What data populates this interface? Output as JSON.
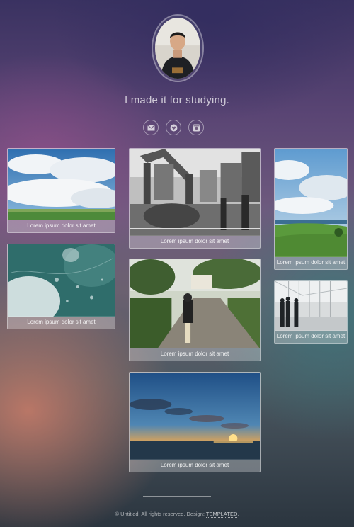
{
  "header": {
    "tagline": "I made it for studying."
  },
  "social": [
    {
      "icon": "envelope-icon"
    },
    {
      "icon": "heart-icon"
    },
    {
      "icon": "camera-icon"
    }
  ],
  "gallery": [
    {
      "caption": "Lorem ipsum dolor sit amet"
    },
    {
      "caption": "Lorem ipsum dolor sit amet"
    },
    {
      "caption": "Lorem ipsum dolor sit amet"
    },
    {
      "caption": "Lorem ipsum dolor sit amet"
    },
    {
      "caption": "Lorem ipsum dolor sit amet"
    },
    {
      "caption": "Lorem ipsum dolor sit amet"
    },
    {
      "caption": "Lorem ipsum dolor sit amet"
    }
  ],
  "footer": {
    "copyright": "© Untitled. All rights reserved. Design: ",
    "credit_link": "TEMPLATED",
    "end": "."
  }
}
